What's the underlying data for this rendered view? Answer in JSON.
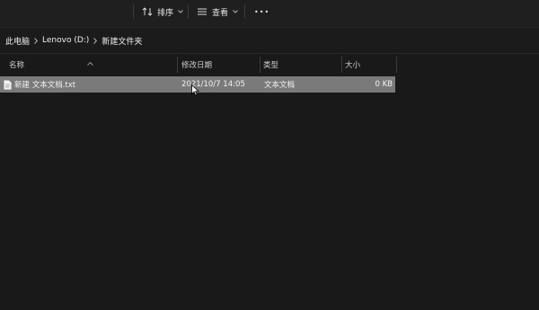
{
  "toolbar": {
    "sort_label": "排序",
    "view_label": "查看",
    "more_label": "•••"
  },
  "breadcrumb": {
    "items": [
      "此电脑",
      "Lenovo (D:)",
      "新建文件夹"
    ]
  },
  "columns": {
    "name": "名称",
    "modified": "修改日期",
    "type": "类型",
    "size": "大小"
  },
  "files": [
    {
      "name": "新建 文本文档.txt",
      "modified": "2021/10/7 14:05",
      "type": "文本文档",
      "size": "0 KB"
    }
  ],
  "colors": {
    "background": "#191919",
    "selected_row": "#7a7a7a",
    "text": "#e8e8e8"
  }
}
